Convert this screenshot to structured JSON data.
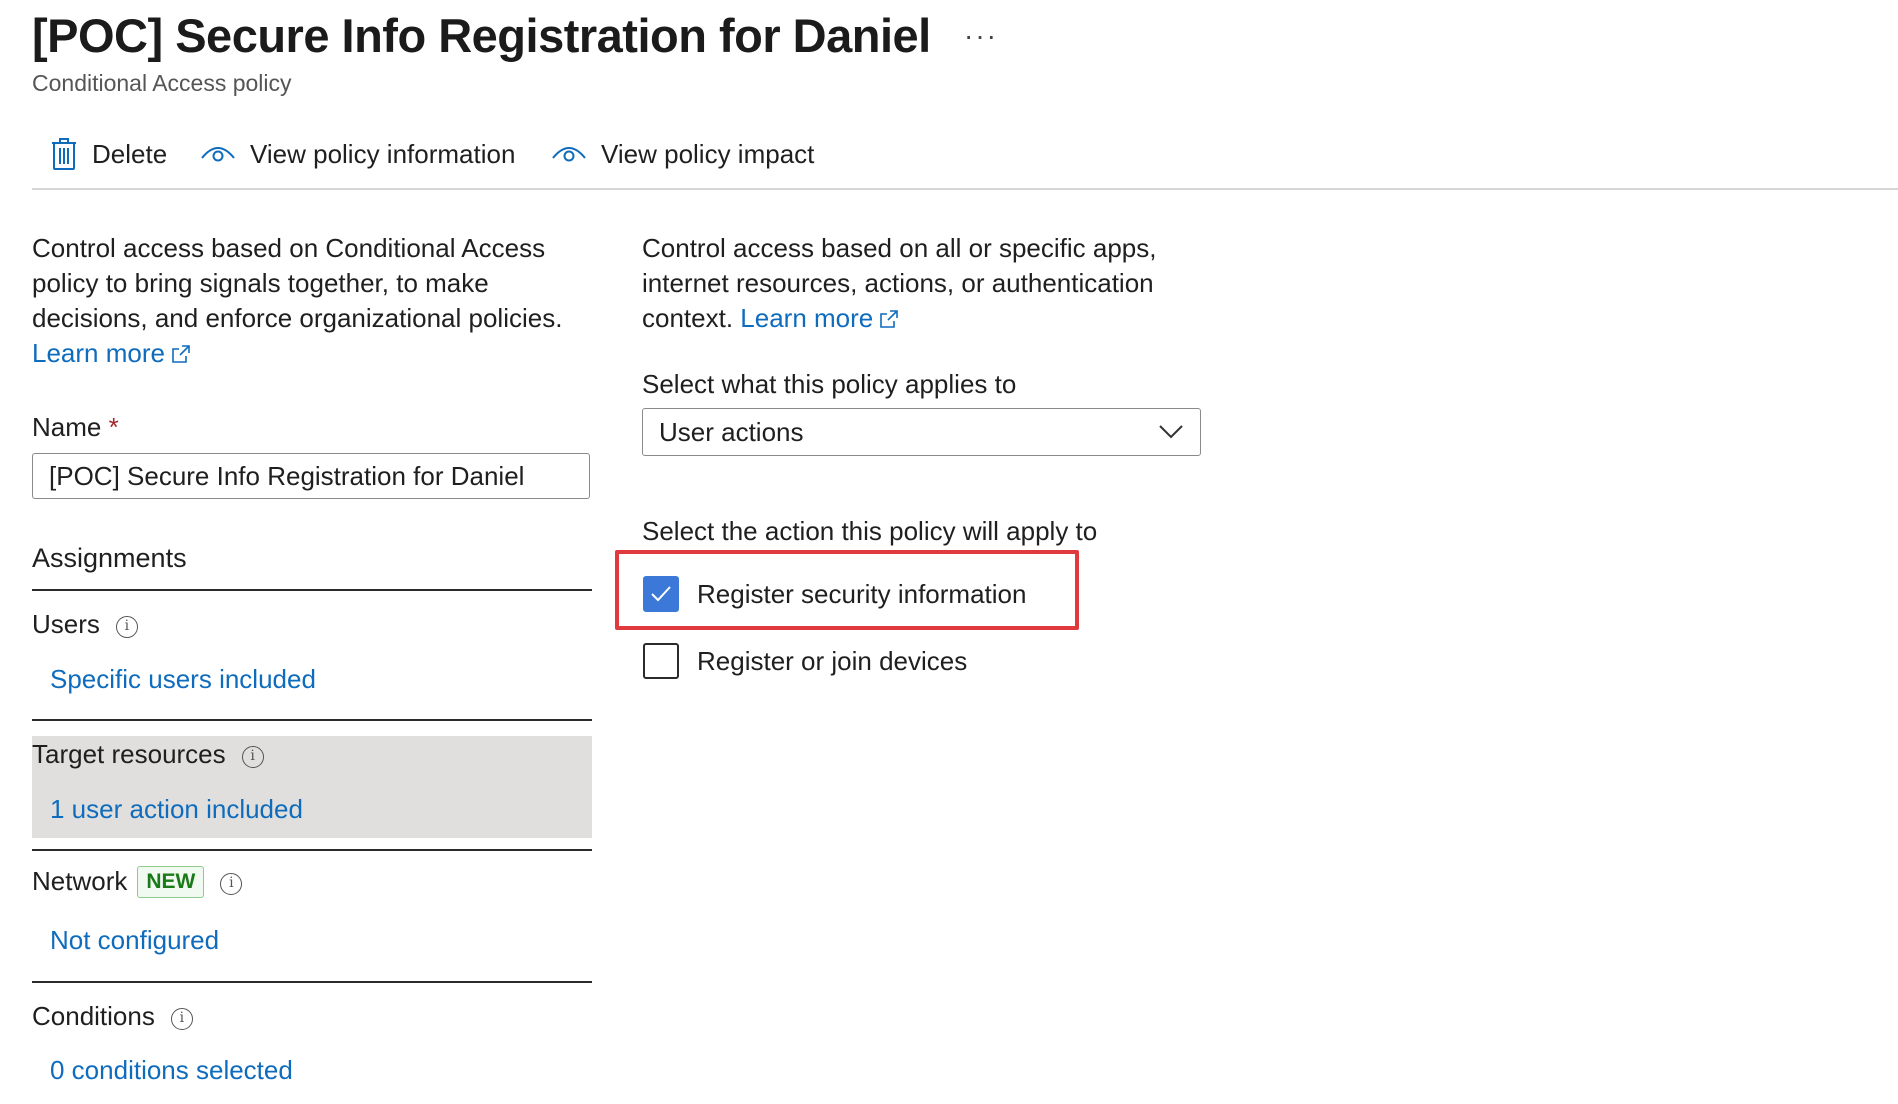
{
  "header": {
    "title": "[POC] Secure Info Registration for Daniel",
    "more_label": "···",
    "subtitle": "Conditional Access policy"
  },
  "toolbar": {
    "delete_label": "Delete",
    "view_info_label": "View policy information",
    "view_impact_label": "View policy impact"
  },
  "left": {
    "description": "Control access based on Conditional Access policy to bring signals together, to make decisions, and enforce organizational policies.",
    "learn_more": "Learn more",
    "name_label": "Name",
    "name_required": "*",
    "name_value": "[POC] Secure Info Registration for Daniel",
    "assignments_heading": "Assignments",
    "users": {
      "label": "Users",
      "value": "Specific users included"
    },
    "target_resources": {
      "label": "Target resources",
      "value": "1 user action included"
    },
    "network": {
      "label": "Network",
      "badge": "NEW",
      "value": "Not configured"
    },
    "conditions": {
      "label": "Conditions",
      "value": "0 conditions selected"
    }
  },
  "right": {
    "description": "Control access based on all or specific apps, internet resources, actions, or authentication context.",
    "learn_more": "Learn more",
    "applies_label": "Select what this policy applies to",
    "applies_value": "User actions",
    "action_label": "Select the action this policy will apply to",
    "actions": [
      {
        "label": "Register security information",
        "checked": true
      },
      {
        "label": "Register or join devices",
        "checked": false
      }
    ]
  },
  "colors": {
    "link": "#0f6cbd",
    "checkbox_checked": "#3b78d8",
    "highlight_border": "#e0393e",
    "selected_row_bg": "#e1dfdd",
    "badge_green": "#1a7a1a"
  },
  "icons": [
    "ellipsis-icon",
    "trash-icon",
    "eye-icon",
    "external-link-icon",
    "info-icon",
    "chevron-down-icon",
    "checkmark-icon"
  ]
}
